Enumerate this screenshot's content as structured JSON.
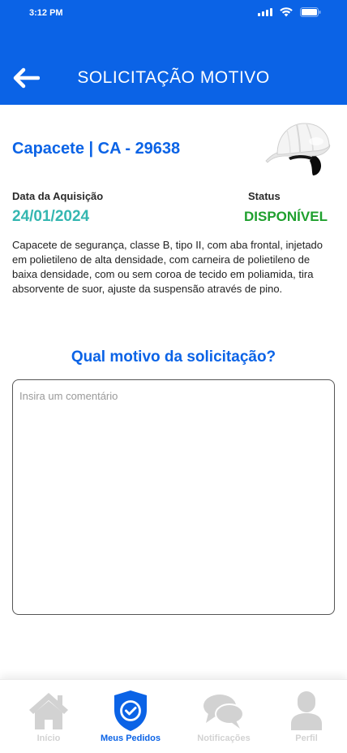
{
  "status_bar": {
    "time": "3:12 PM"
  },
  "header": {
    "title": "SOLICITAÇÃO MOTIVO",
    "back_icon": "arrow-left-icon"
  },
  "item": {
    "name": "Capacete | CA - 29638",
    "image_icon": "white-helmet",
    "acquisition_label": "Data da Aquisição",
    "acquisition_date": "24/01/2024",
    "status_label": "Status",
    "status_value": "DISPONÍVEL",
    "description": "Capacete de segurança, classe B, tipo II, com aba frontal, injetado em polietileno de alta densidade, com carneira de polietileno de baixa densidade, com ou sem coroa de tecido em poliamida, tira absorvente de suor, ajuste da suspensão através de pino."
  },
  "request": {
    "question": "Qual motivo da solicitação?",
    "comment_placeholder": "Insira um comentário",
    "comment_value": ""
  },
  "tabbar": {
    "tabs": [
      {
        "label": "Início",
        "icon": "home-icon",
        "active": false
      },
      {
        "label": "Meus Pedidos",
        "icon": "shield-check-icon",
        "active": true
      },
      {
        "label": "Notificações",
        "icon": "chat-bubbles-icon",
        "active": false
      },
      {
        "label": "Perfil",
        "icon": "user-icon",
        "active": false
      }
    ]
  },
  "colors": {
    "primary": "#0b63e6",
    "date": "#35b7b1",
    "status_available": "#1fa02e",
    "tab_inactive": "#d2d2d2"
  }
}
